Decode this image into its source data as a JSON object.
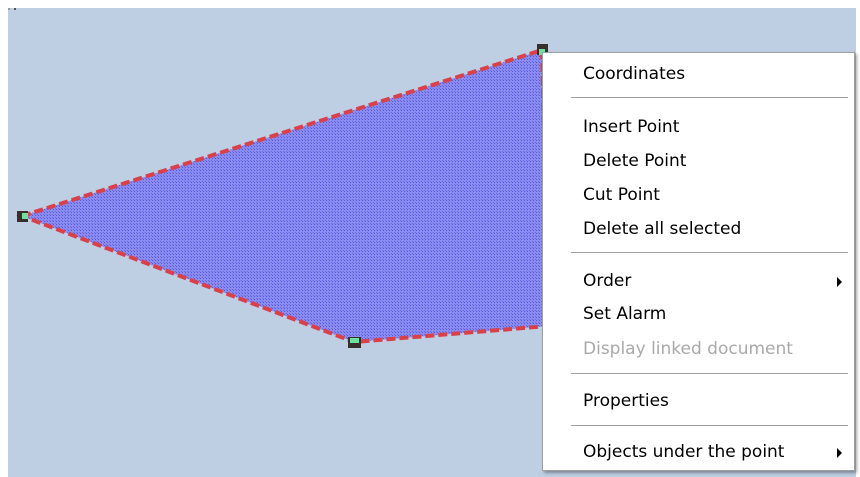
{
  "canvas": {
    "background_color": "#bfcfe3",
    "polygon": {
      "fill_color": "#7f80ee",
      "outline_color": "#d9404a",
      "outline_style": "dashed",
      "handle_color": "#3a2e2a",
      "handle_accent": "#6ee0a0"
    }
  },
  "context_menu": {
    "items": [
      {
        "label": "Coordinates",
        "enabled": true,
        "has_submenu": false
      },
      {
        "label": "Insert Point",
        "enabled": true,
        "has_submenu": false
      },
      {
        "label": "Delete Point",
        "enabled": true,
        "has_submenu": false
      },
      {
        "label": "Cut Point",
        "enabled": true,
        "has_submenu": false
      },
      {
        "label": "Delete all selected",
        "enabled": true,
        "has_submenu": false
      },
      {
        "label": "Order",
        "enabled": true,
        "has_submenu": true
      },
      {
        "label": "Set Alarm",
        "enabled": true,
        "has_submenu": false
      },
      {
        "label": "Display linked document",
        "enabled": false,
        "has_submenu": false
      },
      {
        "label": "Properties",
        "enabled": true,
        "has_submenu": false
      },
      {
        "label": "Objects under the point",
        "enabled": true,
        "has_submenu": true
      }
    ],
    "separator_after": [
      0,
      4,
      7,
      8
    ]
  }
}
